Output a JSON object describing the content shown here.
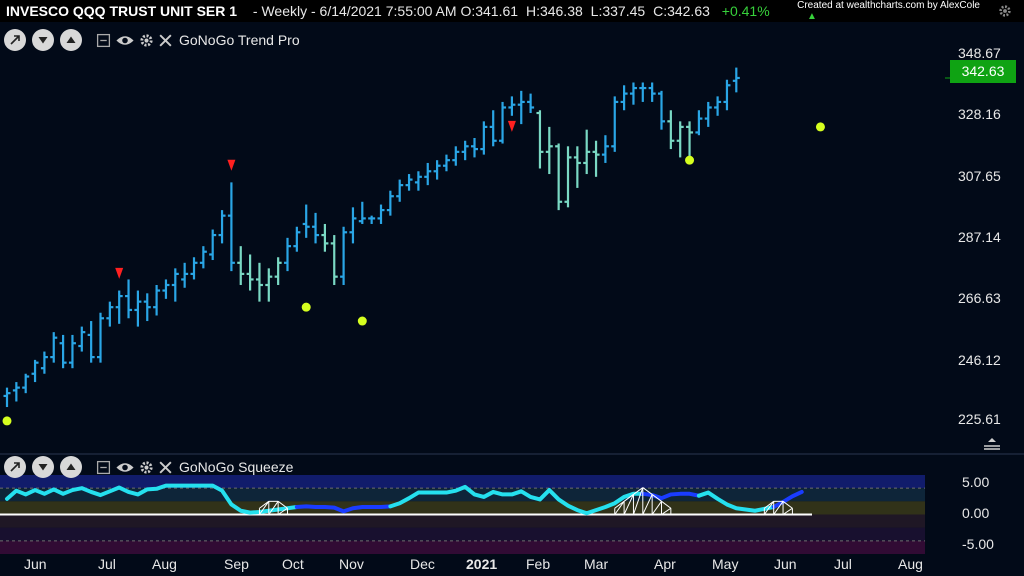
{
  "header": {
    "title": "INVESCO QQQ TRUST UNIT SER 1",
    "info": "- Weekly - 6/14/2021 7:55:00 AM",
    "open_label": "O:",
    "open": "341.61",
    "high_label": "H:",
    "high": "346.38",
    "low_label": "L:",
    "low": "337.45",
    "close_label": "C:",
    "close": "342.63",
    "change": "+0.41%",
    "credit": "Created at wealthcharts.com by AlexCole"
  },
  "price_panel": {
    "indicator_name": "GoNoGo Trend Pro",
    "last_price": "342.63",
    "y_labels": [
      "348.67",
      "328.16",
      "307.65",
      "287.14",
      "266.63",
      "246.12",
      "225.61"
    ]
  },
  "squeeze_panel": {
    "indicator_name": "GoNoGo Squeeze",
    "y_labels": [
      "5.00",
      "0.00",
      "-5.00"
    ]
  },
  "x_labels": [
    "Jun",
    "Jul",
    "Aug",
    "Sep",
    "Oct",
    "Nov",
    "Dec",
    "2021",
    "Feb",
    "Mar",
    "Apr",
    "May",
    "Jun",
    "Jul",
    "Aug"
  ],
  "colors": {
    "go_strong": "#2aa6e6",
    "go_weak": "#7ad9c4",
    "nogo_marker": "#ff2020",
    "dot": "#d6ff1f",
    "squeeze_cyan": "#25e0ee",
    "squeeze_blue": "#1a3cff",
    "price_tag": "#0fa313"
  },
  "chart_data": {
    "type": "ohlc",
    "ylim": [
      215,
      352
    ],
    "bars": [
      {
        "o": 228,
        "h": 231,
        "l": 224,
        "c": 229,
        "col": "b"
      },
      {
        "o": 230,
        "h": 233,
        "l": 226,
        "c": 231,
        "col": "b"
      },
      {
        "o": 231,
        "h": 236,
        "l": 229,
        "c": 235,
        "col": "b"
      },
      {
        "o": 236,
        "h": 241,
        "l": 233,
        "c": 240,
        "col": "b"
      },
      {
        "o": 238,
        "h": 244,
        "l": 236,
        "c": 242,
        "col": "b"
      },
      {
        "o": 242,
        "h": 251,
        "l": 240,
        "c": 249,
        "col": "b"
      },
      {
        "o": 247,
        "h": 250,
        "l": 238,
        "c": 240,
        "col": "b"
      },
      {
        "o": 240,
        "h": 250,
        "l": 238,
        "c": 247,
        "col": "b"
      },
      {
        "o": 246,
        "h": 253,
        "l": 244,
        "c": 251,
        "col": "b"
      },
      {
        "o": 250,
        "h": 255,
        "l": 240,
        "c": 242,
        "col": "b"
      },
      {
        "o": 242,
        "h": 258,
        "l": 240,
        "c": 256,
        "col": "b"
      },
      {
        "o": 256,
        "h": 262,
        "l": 253,
        "c": 260,
        "col": "b"
      },
      {
        "o": 260,
        "h": 266,
        "l": 254,
        "c": 264,
        "col": "b"
      },
      {
        "o": 264,
        "h": 270,
        "l": 256,
        "c": 259,
        "col": "b"
      },
      {
        "o": 259,
        "h": 266,
        "l": 253,
        "c": 262,
        "col": "b"
      },
      {
        "o": 262,
        "h": 265,
        "l": 255,
        "c": 260,
        "col": "b"
      },
      {
        "o": 260,
        "h": 268,
        "l": 257,
        "c": 266,
        "col": "b"
      },
      {
        "o": 266,
        "h": 270,
        "l": 263,
        "c": 268,
        "col": "b"
      },
      {
        "o": 268,
        "h": 274,
        "l": 262,
        "c": 272,
        "col": "b"
      },
      {
        "o": 270,
        "h": 276,
        "l": 267,
        "c": 272,
        "col": "b"
      },
      {
        "o": 272,
        "h": 278,
        "l": 270,
        "c": 276,
        "col": "b"
      },
      {
        "o": 276,
        "h": 282,
        "l": 274,
        "c": 280,
        "col": "b"
      },
      {
        "o": 279,
        "h": 288,
        "l": 277,
        "c": 286,
        "col": "b"
      },
      {
        "o": 286,
        "h": 295,
        "l": 283,
        "c": 293,
        "col": "b"
      },
      {
        "o": 293,
        "h": 305,
        "l": 273,
        "c": 276,
        "col": "b"
      },
      {
        "o": 276,
        "h": 282,
        "l": 268,
        "c": 272,
        "col": "g"
      },
      {
        "o": 272,
        "h": 279,
        "l": 266,
        "c": 270,
        "col": "g"
      },
      {
        "o": 270,
        "h": 276,
        "l": 262,
        "c": 268,
        "col": "g"
      },
      {
        "o": 268,
        "h": 274,
        "l": 262,
        "c": 271,
        "col": "g"
      },
      {
        "o": 271,
        "h": 278,
        "l": 268,
        "c": 276,
        "col": "g"
      },
      {
        "o": 276,
        "h": 285,
        "l": 273,
        "c": 282,
        "col": "b"
      },
      {
        "o": 282,
        "h": 289,
        "l": 280,
        "c": 287,
        "col": "b"
      },
      {
        "o": 290,
        "h": 297,
        "l": 285,
        "c": 289,
        "col": "b"
      },
      {
        "o": 289,
        "h": 294,
        "l": 283,
        "c": 286,
        "col": "b"
      },
      {
        "o": 286,
        "h": 290,
        "l": 280,
        "c": 283,
        "col": "g"
      },
      {
        "o": 283,
        "h": 286,
        "l": 268,
        "c": 271,
        "col": "g"
      },
      {
        "o": 271,
        "h": 289,
        "l": 268,
        "c": 287,
        "col": "b"
      },
      {
        "o": 287,
        "h": 296,
        "l": 283,
        "c": 292,
        "col": "b"
      },
      {
        "o": 291,
        "h": 298,
        "l": 290,
        "c": 292,
        "col": "b"
      },
      {
        "o": 292,
        "h": 293,
        "l": 290,
        "c": 292,
        "col": "b"
      },
      {
        "o": 292,
        "h": 297,
        "l": 290,
        "c": 295,
        "col": "b"
      },
      {
        "o": 295,
        "h": 302,
        "l": 293,
        "c": 300,
        "col": "b"
      },
      {
        "o": 300,
        "h": 306,
        "l": 298,
        "c": 304,
        "col": "b"
      },
      {
        "o": 304,
        "h": 308,
        "l": 302,
        "c": 306,
        "col": "b"
      },
      {
        "o": 305,
        "h": 309,
        "l": 302,
        "c": 307,
        "col": "b"
      },
      {
        "o": 307,
        "h": 312,
        "l": 304,
        "c": 309,
        "col": "b"
      },
      {
        "o": 309,
        "h": 313,
        "l": 306,
        "c": 311,
        "col": "b"
      },
      {
        "o": 311,
        "h": 315,
        "l": 309,
        "c": 313,
        "col": "b"
      },
      {
        "o": 313,
        "h": 318,
        "l": 311,
        "c": 316,
        "col": "b"
      },
      {
        "o": 316,
        "h": 320,
        "l": 313,
        "c": 318,
        "col": "b"
      },
      {
        "o": 318,
        "h": 321,
        "l": 314,
        "c": 317,
        "col": "b"
      },
      {
        "o": 317,
        "h": 327,
        "l": 315,
        "c": 325,
        "col": "b"
      },
      {
        "o": 325,
        "h": 331,
        "l": 318,
        "c": 320,
        "col": "b"
      },
      {
        "o": 320,
        "h": 334,
        "l": 319,
        "c": 332,
        "col": "b"
      },
      {
        "o": 332,
        "h": 336,
        "l": 329,
        "c": 333,
        "col": "b"
      },
      {
        "o": 333,
        "h": 338,
        "l": 326,
        "c": 334,
        "col": "b"
      },
      {
        "o": 334,
        "h": 337,
        "l": 330,
        "c": 332,
        "col": "b"
      },
      {
        "o": 330,
        "h": 331,
        "l": 310,
        "c": 316,
        "col": "g"
      },
      {
        "o": 316,
        "h": 325,
        "l": 308,
        "c": 318,
        "col": "g"
      },
      {
        "o": 318,
        "h": 319,
        "l": 295,
        "c": 298,
        "col": "g"
      },
      {
        "o": 298,
        "h": 318,
        "l": 296,
        "c": 314,
        "col": "g"
      },
      {
        "o": 314,
        "h": 318,
        "l": 303,
        "c": 312,
        "col": "g"
      },
      {
        "o": 312,
        "h": 324,
        "l": 308,
        "c": 316,
        "col": "g"
      },
      {
        "o": 316,
        "h": 320,
        "l": 307,
        "c": 315,
        "col": "g"
      },
      {
        "o": 315,
        "h": 322,
        "l": 312,
        "c": 318,
        "col": "b"
      },
      {
        "o": 318,
        "h": 336,
        "l": 316,
        "c": 334,
        "col": "b"
      },
      {
        "o": 334,
        "h": 340,
        "l": 331,
        "c": 337,
        "col": "b"
      },
      {
        "o": 337,
        "h": 341,
        "l": 333,
        "c": 339,
        "col": "b"
      },
      {
        "o": 339,
        "h": 341,
        "l": 334,
        "c": 339,
        "col": "b"
      },
      {
        "o": 339,
        "h": 341,
        "l": 334,
        "c": 337,
        "col": "b"
      },
      {
        "o": 337,
        "h": 338,
        "l": 324,
        "c": 327,
        "col": "b"
      },
      {
        "o": 327,
        "h": 331,
        "l": 317,
        "c": 320,
        "col": "g"
      },
      {
        "o": 320,
        "h": 327,
        "l": 314,
        "c": 325,
        "col": "g"
      },
      {
        "o": 325,
        "h": 327,
        "l": 314,
        "c": 323,
        "col": "g"
      },
      {
        "o": 323,
        "h": 331,
        "l": 322,
        "c": 328,
        "col": "b"
      },
      {
        "o": 328,
        "h": 334,
        "l": 325,
        "c": 332,
        "col": "b"
      },
      {
        "o": 332,
        "h": 336,
        "l": 329,
        "c": 334,
        "col": "b"
      },
      {
        "o": 334,
        "h": 342,
        "l": 331,
        "c": 340,
        "col": "b"
      },
      {
        "o": 341.61,
        "h": 346.38,
        "l": 337.45,
        "c": 342.63,
        "col": "b"
      }
    ],
    "nogo_markers": [
      {
        "i": 12,
        "v": 272
      },
      {
        "i": 24,
        "v": 311
      },
      {
        "i": 54,
        "v": 325
      }
    ],
    "dots": [
      {
        "i": 0,
        "v": 219
      },
      {
        "i": 32,
        "v": 260
      },
      {
        "i": 38,
        "v": 255
      },
      {
        "i": 73,
        "v": 313
      },
      {
        "i": 87,
        "v": 325
      }
    ],
    "squeeze": {
      "ylim": [
        -6.3,
        6.3
      ],
      "cyan": [
        2.5,
        3.8,
        3.2,
        3.9,
        3.3,
        4.0,
        3.3,
        3.9,
        4.2,
        3.6,
        3.1,
        3.7,
        4.3,
        3.6,
        3.2,
        4.0,
        4.1,
        4.6,
        4.6,
        4.6,
        4.6,
        4.6,
        4.6,
        3.8,
        1.6,
        0.6,
        0.3,
        0.4,
        0.6,
        0.8,
        1.0,
        1.2
      ],
      "blue": [
        1.2,
        1.3,
        1.2,
        1.2,
        1.1,
        0.5,
        1.0,
        1.2,
        1.2,
        1.2,
        1.3
      ],
      "cyan2": [
        1.3,
        1.8,
        2.6,
        3.5,
        3.5,
        3.5,
        3.5,
        3.8,
        4.4,
        3.2,
        2.8,
        3.6,
        3.2,
        3.2,
        3.7,
        2.8,
        2.4,
        3.9,
        2.4,
        1.4,
        0.7,
        0.2,
        0.7,
        1.2,
        1.8,
        2.8,
        3.3,
        3.3
      ],
      "blue2": [
        3.3,
        3.1,
        2.6,
        3.2,
        3.3,
        3.3,
        3.0
      ],
      "cyan3": [
        3.0,
        3.5,
        2.5,
        1.6,
        1.0,
        0.8,
        0.6,
        0.9,
        1.2
      ],
      "blue3": [
        1.2,
        2.0,
        2.9,
        3.6
      ]
    }
  }
}
